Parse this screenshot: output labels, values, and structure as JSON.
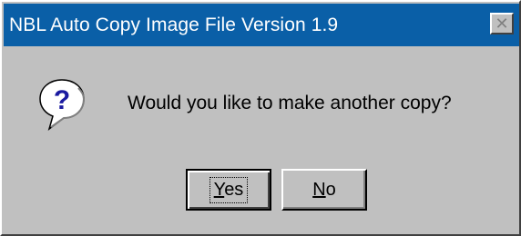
{
  "window": {
    "title": "NBL Auto Copy Image File Version 1.9",
    "close_icon": "close-icon"
  },
  "message": {
    "icon": "question-icon",
    "text": "Would you like to make another copy?"
  },
  "buttons": {
    "yes": {
      "mnemonic": "Y",
      "rest": "es"
    },
    "no": {
      "mnemonic": "N",
      "rest": "o"
    }
  },
  "colors": {
    "titlebar": "#0a5fa7",
    "face": "#c0c0c0",
    "icon_blue": "#1a1aa0"
  }
}
